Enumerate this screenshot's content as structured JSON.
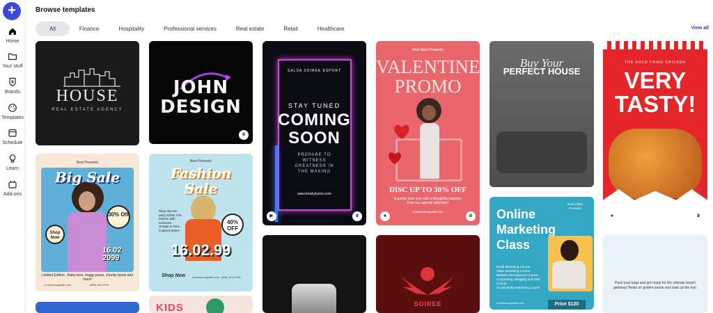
{
  "sidebar": {
    "items": [
      {
        "label": "Home"
      },
      {
        "label": "Your stuff"
      },
      {
        "label": "Brands"
      },
      {
        "label": "Templates"
      },
      {
        "label": "Schedule"
      },
      {
        "label": "Learn"
      },
      {
        "label": "Add-ons"
      }
    ]
  },
  "header": {
    "title": "Browse templates",
    "view_all": "View all"
  },
  "filters": [
    "All",
    "Finance",
    "Hospitality",
    "Professional services",
    "Real estate",
    "Retail",
    "Healthcare"
  ],
  "templates": {
    "house": {
      "title": "HOUSE",
      "subtitle": "REAL ESTATE AGENCY"
    },
    "john": {
      "line1": "JOHN",
      "line2": "DESIGN"
    },
    "neon": {
      "brand": "SALSA SOIREE ESPORT",
      "stay": "STAY TUNED",
      "coming": "COMING",
      "soon": "SOON",
      "tagline": "PREPARE TO WITNESS GREATNESS IN THE MAKING",
      "url": "www.kmskylyeno.com"
    },
    "valentine": {
      "small": "Best Store Presents",
      "line1": "VALENTINE",
      "line2": "PROMO",
      "disc": "DISC UP TO 30% OFF",
      "desc": "Express your love with a thoughtful surprise from our special collection!",
      "url": "a.barnescopysite.com"
    },
    "buyhouse": {
      "line1": "Buy Your",
      "line2": "PERFECT HOUSE"
    },
    "tasty": {
      "small": "THE GOLD FRIED CHICKEN",
      "line1": "VERY",
      "line2": "TASTY!"
    },
    "bigsale": {
      "small": "Best Presents",
      "line1": "Big Sale",
      "discount": "30% Off",
      "date": "16.02 2099",
      "shop": "Shop Now",
      "desc": "Limited Edition - Baby tees, baggy jeans, chunky boots and more!",
      "url": "a.barnescopysite.com",
      "phone": "(855) 413-0753"
    },
    "fashion": {
      "small": "Best Presents",
      "line1": "Fashion",
      "line2": "Sale",
      "desc": "Shop into the early 2000s Y2K fashion with exclusive vintage & retro-inspired styles!",
      "discount": "40% OFF",
      "date": "16.02.99",
      "shop": "Shop Now",
      "url": "a.barnescopysite.com",
      "phone": "(855) 413-0753"
    },
    "soiree": {
      "title": "SOIREE"
    },
    "online": {
      "small": "Best Class Presents",
      "line1": "Online",
      "line2": "Marketing",
      "line3": "Class",
      "items": [
        "Email Marketing Course",
        "Video Marketing Course",
        "Website Development Course",
        "Copywriting, Blogging and SEO Course",
        "Social Media Marketing Course"
      ],
      "url": "a.barnescopysite.com",
      "price": "Price $120"
    },
    "beach": {
      "desc": "Pack your bags and get ready for the ultimate beach getaway! Relax on golden sands and soak up the sun."
    },
    "kids": {
      "title": "KIDS"
    }
  },
  "colors": {
    "accent": "#3b4bd8",
    "link": "#2d3ad3"
  }
}
